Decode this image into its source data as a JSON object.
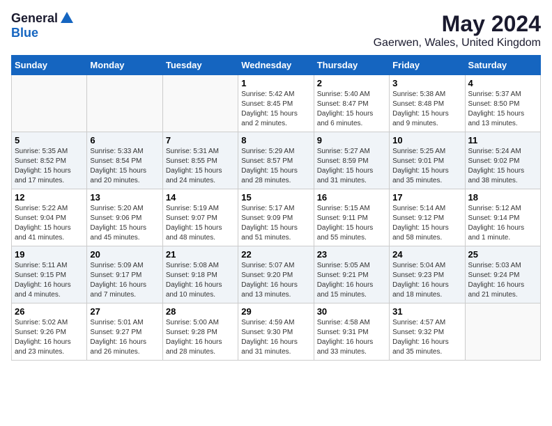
{
  "logo": {
    "general": "General",
    "blue": "Blue"
  },
  "title": "May 2024",
  "location": "Gaerwen, Wales, United Kingdom",
  "days_of_week": [
    "Sunday",
    "Monday",
    "Tuesday",
    "Wednesday",
    "Thursday",
    "Friday",
    "Saturday"
  ],
  "weeks": [
    [
      {
        "num": "",
        "sunrise": "",
        "sunset": "",
        "daylight": ""
      },
      {
        "num": "",
        "sunrise": "",
        "sunset": "",
        "daylight": ""
      },
      {
        "num": "",
        "sunrise": "",
        "sunset": "",
        "daylight": ""
      },
      {
        "num": "1",
        "sunrise": "Sunrise: 5:42 AM",
        "sunset": "Sunset: 8:45 PM",
        "daylight": "Daylight: 15 hours and 2 minutes."
      },
      {
        "num": "2",
        "sunrise": "Sunrise: 5:40 AM",
        "sunset": "Sunset: 8:47 PM",
        "daylight": "Daylight: 15 hours and 6 minutes."
      },
      {
        "num": "3",
        "sunrise": "Sunrise: 5:38 AM",
        "sunset": "Sunset: 8:48 PM",
        "daylight": "Daylight: 15 hours and 9 minutes."
      },
      {
        "num": "4",
        "sunrise": "Sunrise: 5:37 AM",
        "sunset": "Sunset: 8:50 PM",
        "daylight": "Daylight: 15 hours and 13 minutes."
      }
    ],
    [
      {
        "num": "5",
        "sunrise": "Sunrise: 5:35 AM",
        "sunset": "Sunset: 8:52 PM",
        "daylight": "Daylight: 15 hours and 17 minutes."
      },
      {
        "num": "6",
        "sunrise": "Sunrise: 5:33 AM",
        "sunset": "Sunset: 8:54 PM",
        "daylight": "Daylight: 15 hours and 20 minutes."
      },
      {
        "num": "7",
        "sunrise": "Sunrise: 5:31 AM",
        "sunset": "Sunset: 8:55 PM",
        "daylight": "Daylight: 15 hours and 24 minutes."
      },
      {
        "num": "8",
        "sunrise": "Sunrise: 5:29 AM",
        "sunset": "Sunset: 8:57 PM",
        "daylight": "Daylight: 15 hours and 28 minutes."
      },
      {
        "num": "9",
        "sunrise": "Sunrise: 5:27 AM",
        "sunset": "Sunset: 8:59 PM",
        "daylight": "Daylight: 15 hours and 31 minutes."
      },
      {
        "num": "10",
        "sunrise": "Sunrise: 5:25 AM",
        "sunset": "Sunset: 9:01 PM",
        "daylight": "Daylight: 15 hours and 35 minutes."
      },
      {
        "num": "11",
        "sunrise": "Sunrise: 5:24 AM",
        "sunset": "Sunset: 9:02 PM",
        "daylight": "Daylight: 15 hours and 38 minutes."
      }
    ],
    [
      {
        "num": "12",
        "sunrise": "Sunrise: 5:22 AM",
        "sunset": "Sunset: 9:04 PM",
        "daylight": "Daylight: 15 hours and 41 minutes."
      },
      {
        "num": "13",
        "sunrise": "Sunrise: 5:20 AM",
        "sunset": "Sunset: 9:06 PM",
        "daylight": "Daylight: 15 hours and 45 minutes."
      },
      {
        "num": "14",
        "sunrise": "Sunrise: 5:19 AM",
        "sunset": "Sunset: 9:07 PM",
        "daylight": "Daylight: 15 hours and 48 minutes."
      },
      {
        "num": "15",
        "sunrise": "Sunrise: 5:17 AM",
        "sunset": "Sunset: 9:09 PM",
        "daylight": "Daylight: 15 hours and 51 minutes."
      },
      {
        "num": "16",
        "sunrise": "Sunrise: 5:15 AM",
        "sunset": "Sunset: 9:11 PM",
        "daylight": "Daylight: 15 hours and 55 minutes."
      },
      {
        "num": "17",
        "sunrise": "Sunrise: 5:14 AM",
        "sunset": "Sunset: 9:12 PM",
        "daylight": "Daylight: 15 hours and 58 minutes."
      },
      {
        "num": "18",
        "sunrise": "Sunrise: 5:12 AM",
        "sunset": "Sunset: 9:14 PM",
        "daylight": "Daylight: 16 hours and 1 minute."
      }
    ],
    [
      {
        "num": "19",
        "sunrise": "Sunrise: 5:11 AM",
        "sunset": "Sunset: 9:15 PM",
        "daylight": "Daylight: 16 hours and 4 minutes."
      },
      {
        "num": "20",
        "sunrise": "Sunrise: 5:09 AM",
        "sunset": "Sunset: 9:17 PM",
        "daylight": "Daylight: 16 hours and 7 minutes."
      },
      {
        "num": "21",
        "sunrise": "Sunrise: 5:08 AM",
        "sunset": "Sunset: 9:18 PM",
        "daylight": "Daylight: 16 hours and 10 minutes."
      },
      {
        "num": "22",
        "sunrise": "Sunrise: 5:07 AM",
        "sunset": "Sunset: 9:20 PM",
        "daylight": "Daylight: 16 hours and 13 minutes."
      },
      {
        "num": "23",
        "sunrise": "Sunrise: 5:05 AM",
        "sunset": "Sunset: 9:21 PM",
        "daylight": "Daylight: 16 hours and 15 minutes."
      },
      {
        "num": "24",
        "sunrise": "Sunrise: 5:04 AM",
        "sunset": "Sunset: 9:23 PM",
        "daylight": "Daylight: 16 hours and 18 minutes."
      },
      {
        "num": "25",
        "sunrise": "Sunrise: 5:03 AM",
        "sunset": "Sunset: 9:24 PM",
        "daylight": "Daylight: 16 hours and 21 minutes."
      }
    ],
    [
      {
        "num": "26",
        "sunrise": "Sunrise: 5:02 AM",
        "sunset": "Sunset: 9:26 PM",
        "daylight": "Daylight: 16 hours and 23 minutes."
      },
      {
        "num": "27",
        "sunrise": "Sunrise: 5:01 AM",
        "sunset": "Sunset: 9:27 PM",
        "daylight": "Daylight: 16 hours and 26 minutes."
      },
      {
        "num": "28",
        "sunrise": "Sunrise: 5:00 AM",
        "sunset": "Sunset: 9:28 PM",
        "daylight": "Daylight: 16 hours and 28 minutes."
      },
      {
        "num": "29",
        "sunrise": "Sunrise: 4:59 AM",
        "sunset": "Sunset: 9:30 PM",
        "daylight": "Daylight: 16 hours and 31 minutes."
      },
      {
        "num": "30",
        "sunrise": "Sunrise: 4:58 AM",
        "sunset": "Sunset: 9:31 PM",
        "daylight": "Daylight: 16 hours and 33 minutes."
      },
      {
        "num": "31",
        "sunrise": "Sunrise: 4:57 AM",
        "sunset": "Sunset: 9:32 PM",
        "daylight": "Daylight: 16 hours and 35 minutes."
      },
      {
        "num": "",
        "sunrise": "",
        "sunset": "",
        "daylight": ""
      }
    ]
  ]
}
